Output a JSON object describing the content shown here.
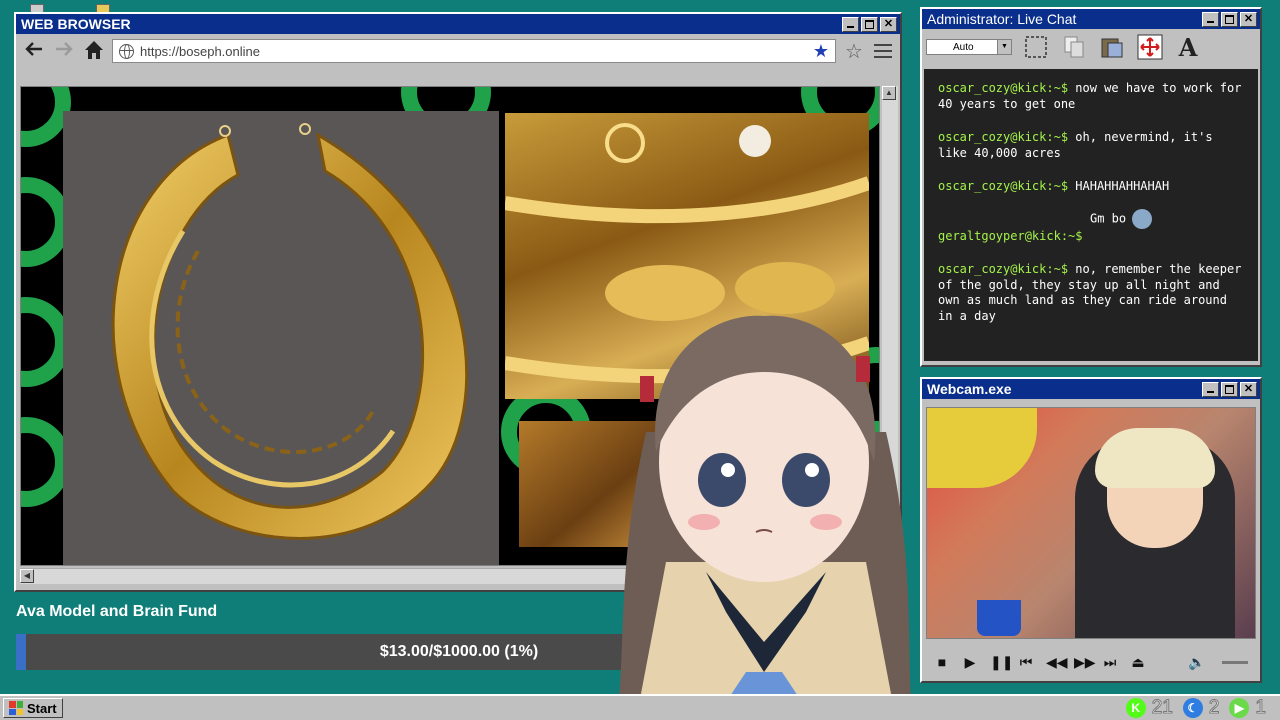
{
  "desktop": {
    "background_color": "#0f7e78"
  },
  "browser": {
    "title": "WEB BROWSER",
    "url": "https://boseph.online",
    "icons": {
      "back": "back-arrow-icon",
      "forward": "forward-arrow-icon",
      "home": "home-icon",
      "bookmarked": "star-filled-icon",
      "bookmark": "star-outline-icon",
      "menu": "hamburger-menu-icon"
    }
  },
  "chat": {
    "title": "Administrator: Live Chat",
    "font_size_select": "Auto",
    "messages": [
      {
        "user": "oscar_cozy@kick:~$",
        "text": "now we have to work for 40 years to get one"
      },
      {
        "user": "oscar_cozy@kick:~$",
        "text": "oh, nevermind, it's like 40,000 acres"
      },
      {
        "user": "oscar_cozy@kick:~$",
        "text": "HAHAHHAHHAHAH"
      },
      {
        "user": "geraltgoyper@kick:~$",
        "text": "Gm bo"
      },
      {
        "user": "oscar_cozy@kick:~$",
        "text": "no, remember the keeper of the gold, they stay up all night and own as much land as they can ride around in a day"
      }
    ],
    "colors": {
      "username": "#a4f24a",
      "background": "#222222"
    }
  },
  "webcam": {
    "title": "Webcam.exe"
  },
  "fund": {
    "title": "Ava Model and Brain Fund",
    "progress_text": "$13.00/$1000.00 (1%)",
    "progress_fraction": 0.01,
    "fill_color": "#3a6fc8"
  },
  "taskbar": {
    "start_label": "Start",
    "tray": [
      {
        "icon": "kick-icon",
        "value": "21",
        "color": "#53fc18"
      },
      {
        "icon": "moon-icon",
        "value": "2",
        "color": "#2f7de1"
      },
      {
        "icon": "play-icon",
        "value": "1",
        "color": "#6ad94a"
      }
    ]
  }
}
